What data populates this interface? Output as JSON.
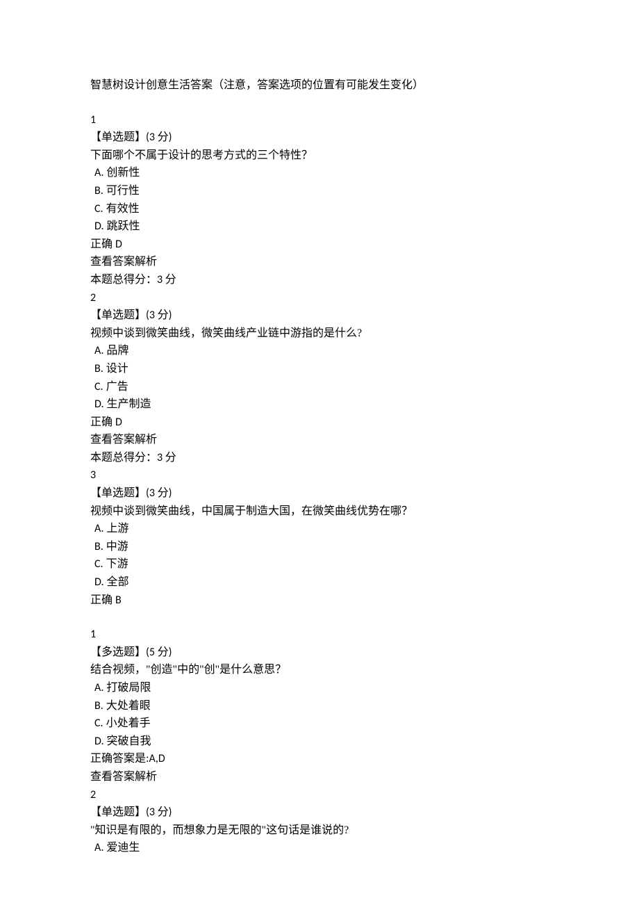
{
  "title": "智慧树设计创意生活答案（注意，答案选项的位置有可能发生变化）",
  "questions": [
    {
      "number": "1",
      "type_label": "【单选题】",
      "points": "(3 分)",
      "question": "下面哪个不属于设计的思考方式的三个特性？",
      "options": [
        {
          "letter": "A.",
          "text": "创新性"
        },
        {
          "letter": "B.",
          "text": "可行性"
        },
        {
          "letter": "C.",
          "text": "有效性"
        },
        {
          "letter": "D.",
          "text": "跳跃性"
        }
      ],
      "correct_prefix": "正确 ",
      "correct_answer": "D",
      "view_label": "查看答案解析",
      "total_score_label": "本题总得分：",
      "total_score": "3 分"
    },
    {
      "number": "2",
      "type_label": "【单选题】",
      "points": "(3 分)",
      "question": "视频中谈到微笑曲线，微笑曲线产业链中游指的是什么?",
      "options": [
        {
          "letter": "A.",
          "text": "品牌"
        },
        {
          "letter": "B.",
          "text": "设计"
        },
        {
          "letter": "C.",
          "text": "广告"
        },
        {
          "letter": "D.",
          "text": "生产制造"
        }
      ],
      "correct_prefix": "正确 ",
      "correct_answer": "D",
      "view_label": "查看答案解析",
      "total_score_label": "本题总得分：",
      "total_score": "3 分"
    },
    {
      "number": "3",
      "type_label": "【单选题】",
      "points": "(3 分)",
      "question": "视频中谈到微笑曲线，中国属于制造大国，在微笑曲线优势在哪？",
      "options": [
        {
          "letter": "A.",
          "text": "上游"
        },
        {
          "letter": "B.",
          "text": "中游"
        },
        {
          "letter": "C.",
          "text": "下游"
        },
        {
          "letter": "D.",
          "text": "全部"
        }
      ],
      "correct_prefix": "正确 ",
      "correct_answer": "B"
    },
    {
      "number": "1",
      "type_label": "【多选题】",
      "points": "(5 分)",
      "question": "结合视频，\"创造\"中的\"创\"是什么意思？",
      "options": [
        {
          "letter": "A.",
          "text": "打破局限"
        },
        {
          "letter": "B.",
          "text": "大处着眼"
        },
        {
          "letter": "C.",
          "text": "小处着手"
        },
        {
          "letter": "D.",
          "text": "突破自我"
        }
      ],
      "correct_label_full": "正确答案是:",
      "correct_answer": "A,D",
      "view_label": "查看答案解析"
    },
    {
      "number": "2",
      "type_label": "【单选题】",
      "points": "(3 分)",
      "question": "\"知识是有限的，而想象力是无限的\"这句话是谁说的?",
      "options": [
        {
          "letter": "A.",
          "text": "爱迪生"
        }
      ]
    }
  ]
}
